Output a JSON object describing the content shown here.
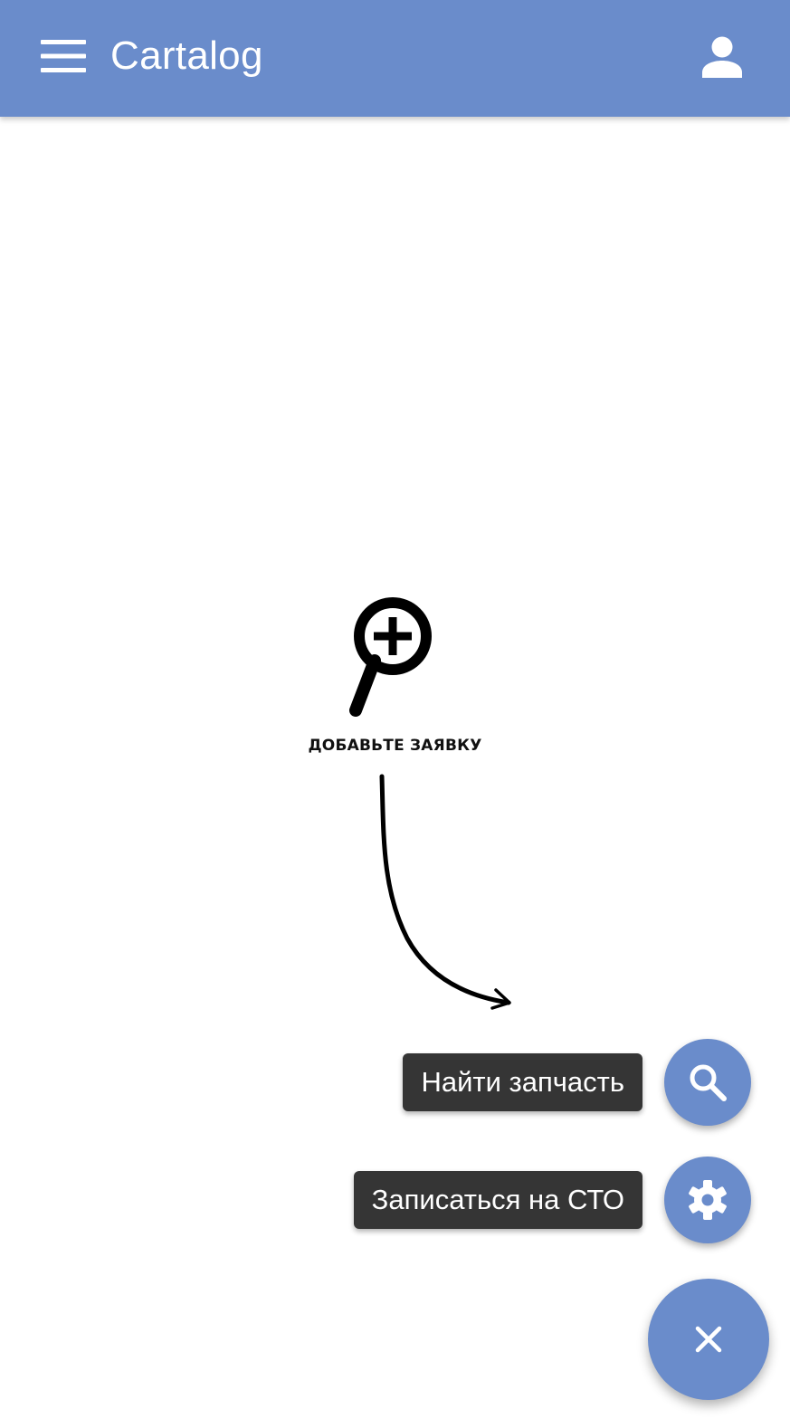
{
  "app_bar": {
    "title": "Cartalog",
    "menu_icon": "hamburger-menu-icon",
    "account_icon": "account-icon",
    "background_color": "#6a8ccb"
  },
  "empty_state": {
    "icon": "magnifier-plus-icon",
    "message": "ДОБАВЬТЕ ЗАЯВКУ",
    "arrow_icon": "curved-arrow-icon"
  },
  "fab_menu": {
    "actions": [
      {
        "label": "Найти запчасть",
        "icon": "search-icon"
      },
      {
        "label": "Записаться на СТО",
        "icon": "gear-icon"
      }
    ],
    "main_icon": "close-icon",
    "accent_color": "#6a8ccb",
    "label_background": "#353535"
  }
}
